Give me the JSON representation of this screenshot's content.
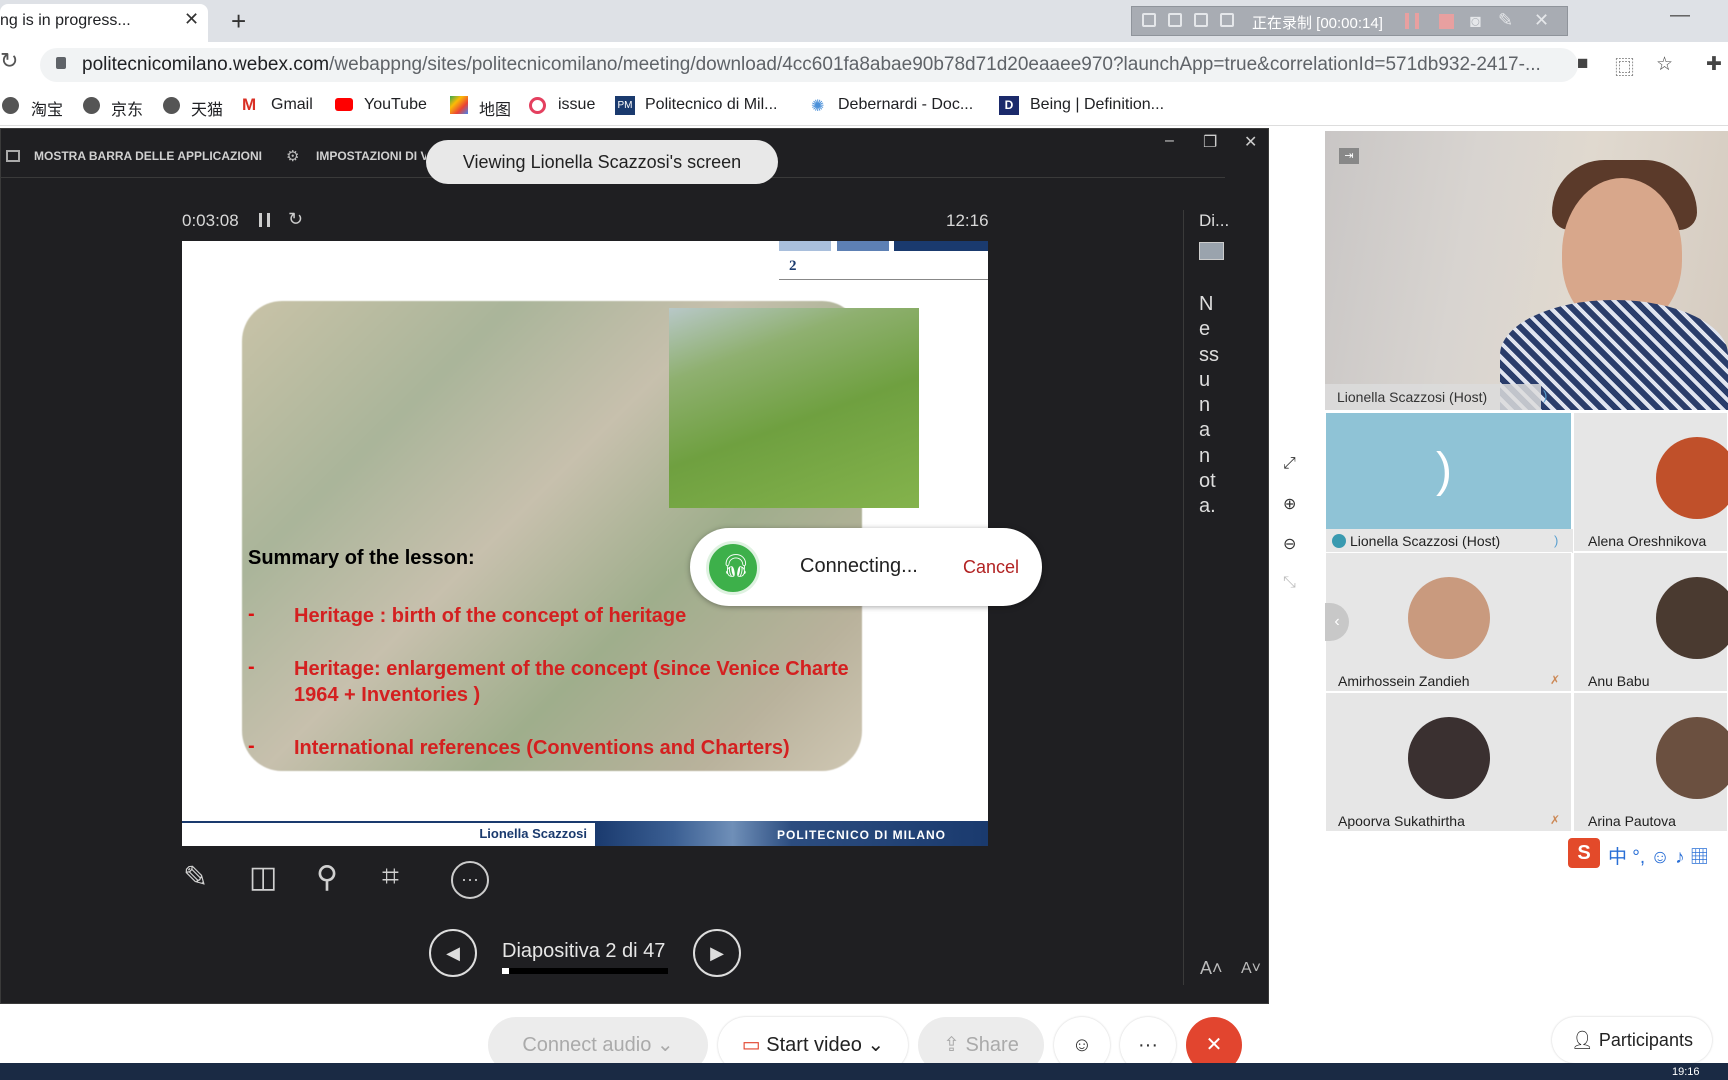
{
  "browser": {
    "tab_title": "ng is in progress...",
    "tab_close": "✕",
    "new_tab": "+",
    "window_min": "—",
    "url_host": "politecnicomilano.webex.com",
    "url_path": "/webappng/sites/politecnicomilano/meeting/download/4cc601fa8abae90b78d71d20eaaee970?launchApp=true&correlationId=571db932-2417-...",
    "bookmarks": [
      "淘宝",
      "京东",
      "天猫",
      "Gmail",
      "YouTube",
      "地图",
      "issue",
      "Politecnico di Mil...",
      "Debernardi - Doc...",
      "Being | Definition..."
    ]
  },
  "recorder": {
    "status": "正在录制 [00:00:14]"
  },
  "presentation_bar": {
    "show_taskbar": "MOSTRA BARRA DELLE APPLICAZIONI",
    "display_settings": "IMPOSTAZIONI DI VISUALIZZAZIONE ▾",
    "viewing_banner": "Viewing Lionella Scazzosi's screen"
  },
  "presenter": {
    "elapsed": "0:03:08",
    "clock": "12:16",
    "slide_counter": "Diapositiva 2 di 47",
    "progress_fraction": 0.0426,
    "notes_title": "Di...",
    "notes_text": "Nessuna nota."
  },
  "slide": {
    "number": "2",
    "summary_title": "Summary of the lesson:",
    "points": [
      {
        "dash": "-",
        "text": "Heritage : birth of the concept of heritage"
      },
      {
        "dash": "-",
        "text": "Heritage:  enlargement of the concept (since Venice Charte 1964 + Inventories )"
      },
      {
        "dash": "-",
        "text": "International references (Conventions and Charters)"
      }
    ],
    "footer_author": "Lionella Scazzosi",
    "footer_uni": "POLITECNICO DI MILANO"
  },
  "connecting": {
    "label": "Connecting...",
    "cancel": "Cancel"
  },
  "participants": {
    "host_name": "Lionella Scazzosi (Host)",
    "tiles": [
      {
        "name": "Lionella Scazzosi (Host)",
        "color": "#8fc3d6"
      },
      {
        "name": "Alena Oreshnikova",
        "color": "#c0502a"
      },
      {
        "name": "Amirhossein Zandieh",
        "color": "#c99a7e"
      },
      {
        "name": "Anu Babu",
        "color": "#4a3a30"
      },
      {
        "name": "Apoorva Sukathirtha",
        "color": "#3a3030"
      },
      {
        "name": "Arina Pautova",
        "color": "#6b5040"
      }
    ]
  },
  "bottom_bar": {
    "connect_audio": "Connect audio",
    "start_video": "Start video",
    "share": "Share",
    "more": "···",
    "leave": "✕",
    "participants": "Participants"
  },
  "ime": {
    "logo": "S",
    "text": "中 °, ☺ ♪ ▦"
  },
  "taskbar": {
    "time": "19:16"
  },
  "colors": {
    "leave_red": "#e2452f",
    "webex_green": "#3db04a",
    "slide_red": "#d42020",
    "polimi_blue": "#1a3a6e"
  }
}
